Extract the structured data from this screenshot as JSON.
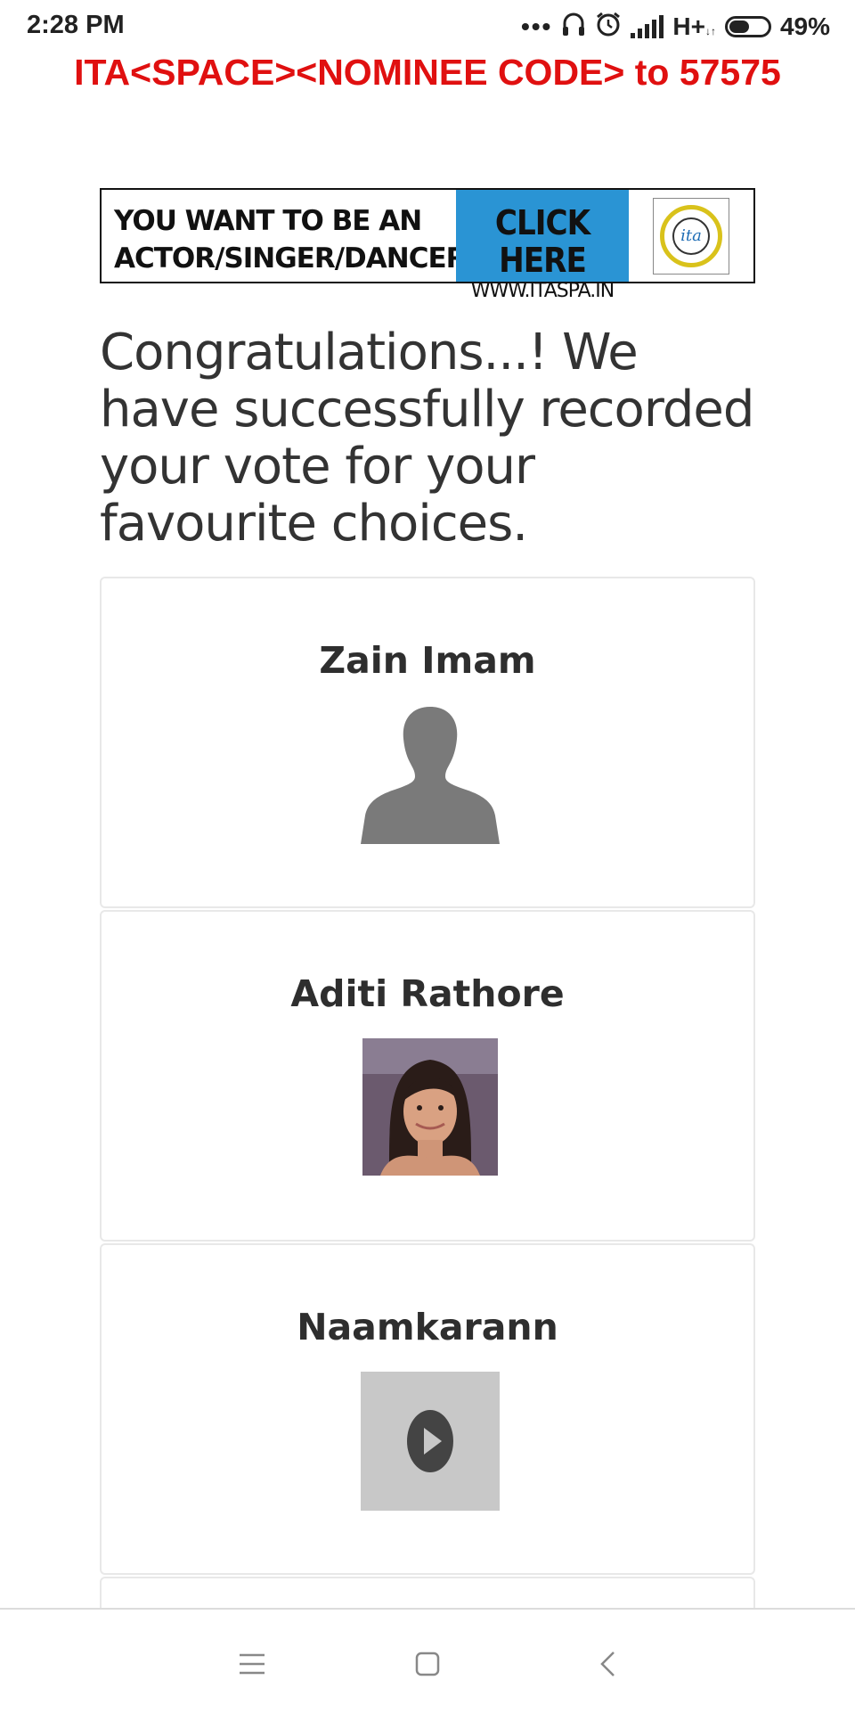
{
  "status_bar": {
    "time": "2:28 PM",
    "dots": "•••",
    "network": "H+",
    "network_sub": "↓↑",
    "battery": "49%"
  },
  "vote_instruction": "ITA<SPACE><NOMINEE CODE> to 57575",
  "banner": {
    "line1": "YOU WANT TO BE AN",
    "line2": "ACTOR/SINGER/DANCER?",
    "cta": "CLICK HERE",
    "url": "WWW.ITASPA.IN",
    "logo_text": "ita"
  },
  "message": "Congratulations...! We have successfully recorded your vote for your favourite choices.",
  "choices": [
    {
      "name": "Zain Imam",
      "image": "person-silhouette"
    },
    {
      "name": "Aditi Rathore",
      "image": "photo"
    },
    {
      "name": "Naamkarann",
      "image": "video-placeholder"
    }
  ],
  "nav": {
    "menu_icon": "menu-icon",
    "home_icon": "home-icon",
    "back_icon": "back-icon"
  }
}
